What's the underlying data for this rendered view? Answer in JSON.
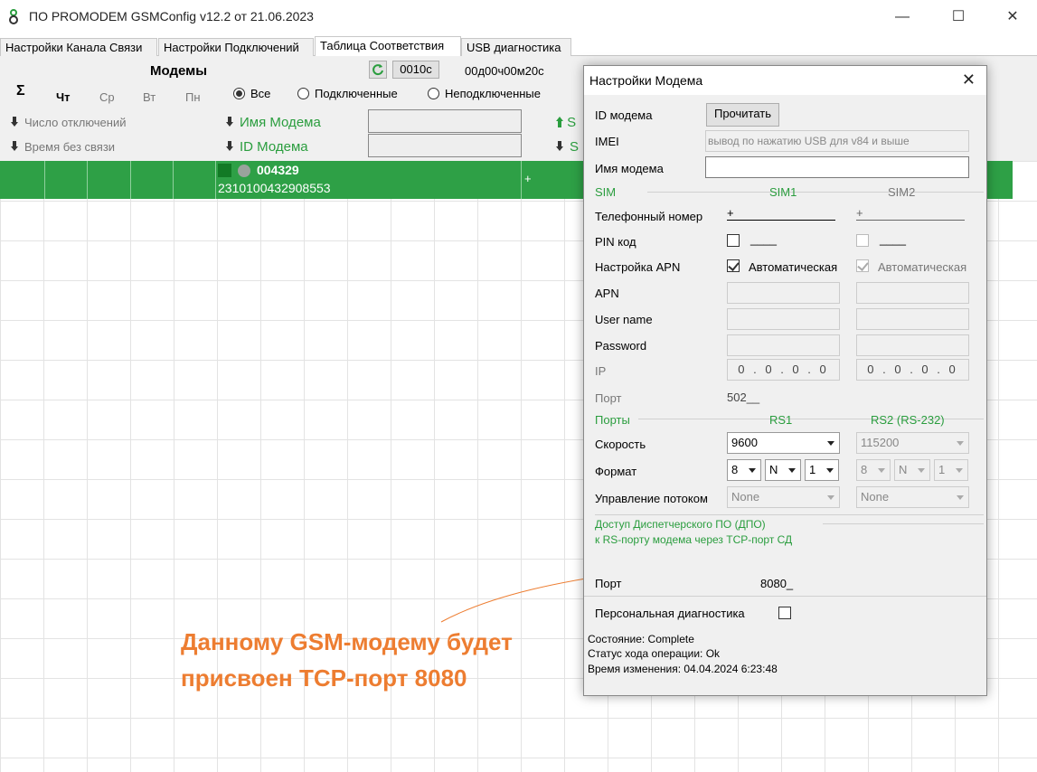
{
  "window": {
    "title": "ПО PROMODEM GSMConfig v12.2 от 21.06.2023",
    "minimize": "—",
    "maximize": "☐",
    "close": "✕"
  },
  "tabs": [
    {
      "label": "Настройки Канала Связи"
    },
    {
      "label": "Настройки Подключений"
    },
    {
      "label": "Таблица Соответствия"
    },
    {
      "label": "USB диагностика"
    }
  ],
  "panel": {
    "title": "Модемы",
    "sigma": "Σ",
    "days": [
      "Чт",
      "Ср",
      "Вт",
      "Пн"
    ],
    "interval": "0010с",
    "timer": "00д00ч00м20с",
    "radios": [
      {
        "label": "Все",
        "checked": true
      },
      {
        "label": "Подключенные",
        "checked": false
      },
      {
        "label": "Неподключенные",
        "checked": false
      }
    ],
    "sort_disconnects": "Число отключений",
    "sort_no_link": "Время без связи",
    "modem_name_label": "Имя Модема",
    "modem_id_label": "ID Модема",
    "s1": "S",
    "s2": "S"
  },
  "row": {
    "modem_name": "004329",
    "modem_id": "2310100432908553",
    "plus": "+"
  },
  "dialog": {
    "title": "Настройки Модема",
    "id_label": "ID модема",
    "read_button": "Прочитать",
    "imei_label": "IMEI",
    "imei_placeholder": "вывод по нажатию USB для v84 и выше",
    "name_label": "Имя модема",
    "name_value": "",
    "sim_section": "SIM",
    "sim1": "SIM1",
    "sim2": "SIM2",
    "phone_label": "Телефонный номер",
    "phone1": "+",
    "phone2": "+",
    "pin_label": "PIN код",
    "pin1": "____",
    "pin2": "____",
    "apn_setting_label": "Настройка APN",
    "apn_auto1": "Автоматическая",
    "apn_auto2": "Автоматическая",
    "apn_label": "APN",
    "user_label": "User name",
    "password_label": "Password",
    "ip_label": "IP",
    "ip1": "0 . 0 . 0 . 0",
    "ip2": "0 . 0 . 0 . 0",
    "port_label": "Порт",
    "port_value": "502__",
    "ports_section": "Порты",
    "rs1": "RS1",
    "rs2": "RS2 (RS-232)",
    "speed_label": "Скорость",
    "speed1": "9600",
    "speed2": "115200",
    "format_label": "Формат",
    "format1": [
      "8",
      "N",
      "1"
    ],
    "format2": [
      "8",
      "N",
      "1"
    ],
    "flow_label": "Управление потоком",
    "flow1": "None",
    "flow2": "None",
    "dpo_line1": "Доступ Диспетчерского ПО (ДПО)",
    "dpo_line2": "к RS-порту модема через TCP-порт СД",
    "tcp_port_label": "Порт",
    "tcp_port_value": "8080_",
    "personal_diag_label": "Персональная диагностика",
    "status_state": "Состояние: Complete",
    "status_op": "Статус хода операции: Ok",
    "status_time": "Время изменения: 04.04.2024 6:23:48"
  },
  "annotation": {
    "text": "Данному GSM-модему будет\nприсвоен TCP-порт 8080",
    "color": "#ed7d31"
  },
  "colors": {
    "accent_green": "#2ea046",
    "label_green": "#2a9d3e"
  }
}
